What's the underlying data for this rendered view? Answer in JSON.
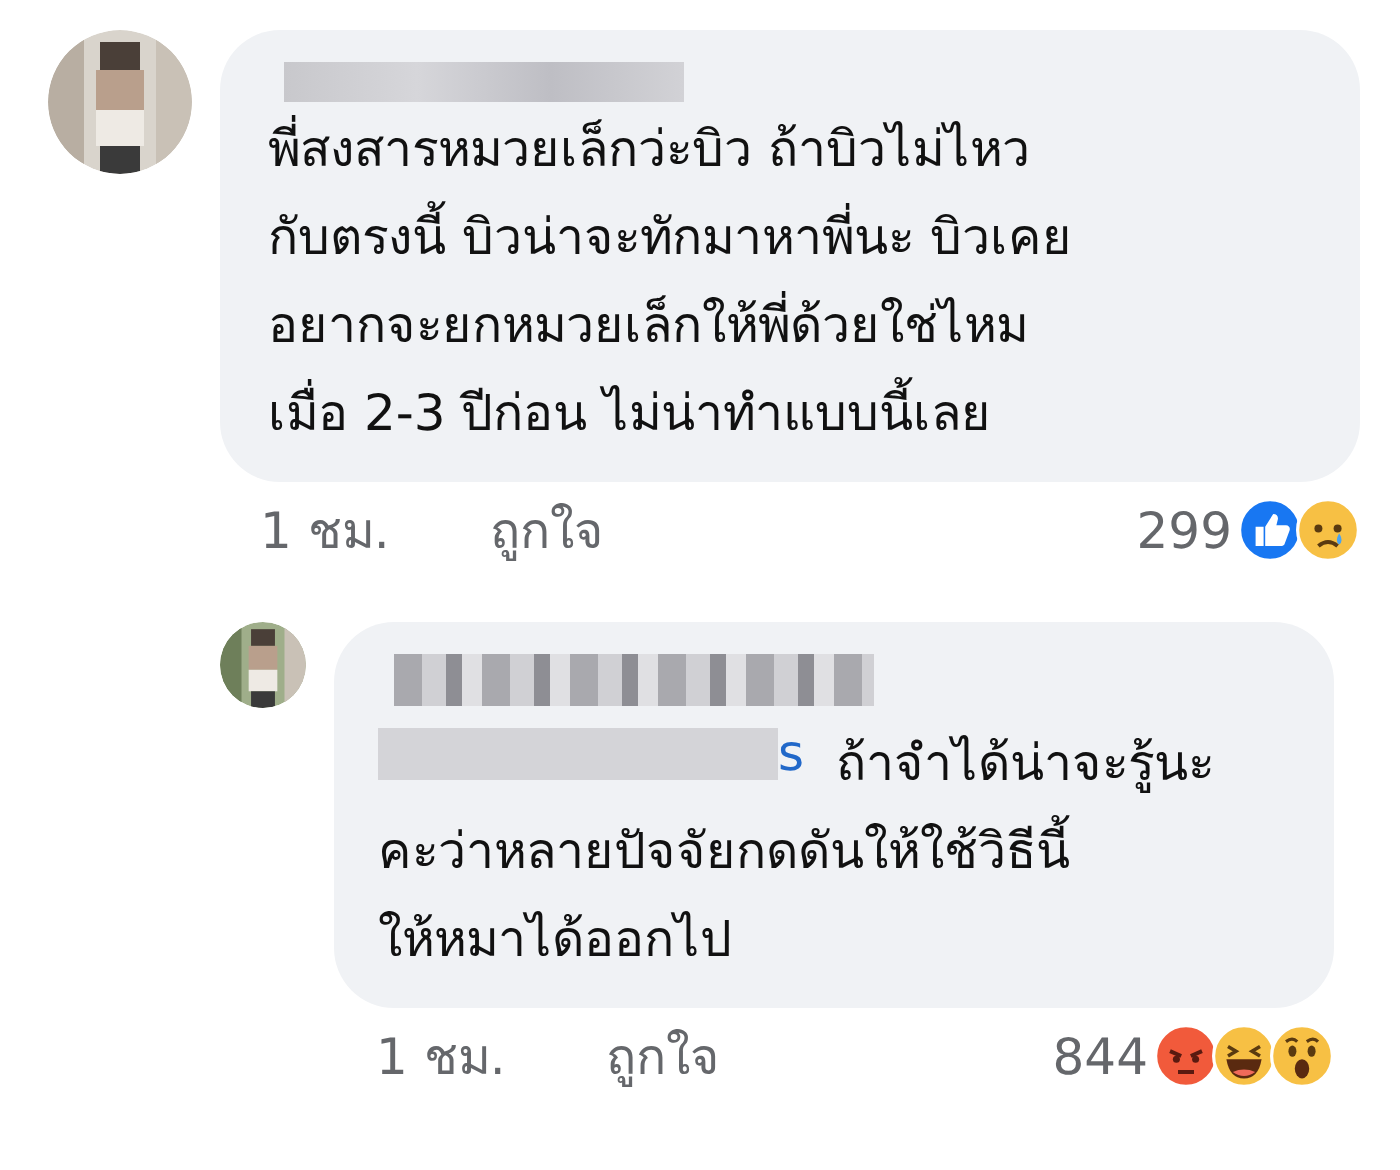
{
  "comments": [
    {
      "kind": "comment",
      "text": "พี่สงสารหมวยเล็กว่ะบิว ถ้าบิวไม่ไหว\nกับตรงนี้ บิวน่าจะทักมาหาพี่นะ บิวเคย\nอยากจะยกหมวยเล็กให้พี่ด้วยใช่ไหม\nเมื่อ 2-3 ปีก่อน ไม่น่าทำแบบนี้เลย",
      "time": "1 ชม.",
      "like_label": "ถูกใจ",
      "reaction_count": "299",
      "reactions": [
        {
          "kind": "like"
        },
        {
          "kind": "sad"
        }
      ]
    },
    {
      "kind": "reply",
      "mention_visible": "s",
      "text": "ถ้าจำได้น่าจะรู้นะ\nคะว่าหลายปัจจัยกดดันให้ใช้วิธีนี้\nให้หมาได้ออกไป",
      "time": "1 ชม.",
      "like_label": "ถูกใจ",
      "reaction_count": "844",
      "reactions": [
        {
          "kind": "angry"
        },
        {
          "kind": "haha"
        },
        {
          "kind": "wow"
        }
      ]
    }
  ]
}
